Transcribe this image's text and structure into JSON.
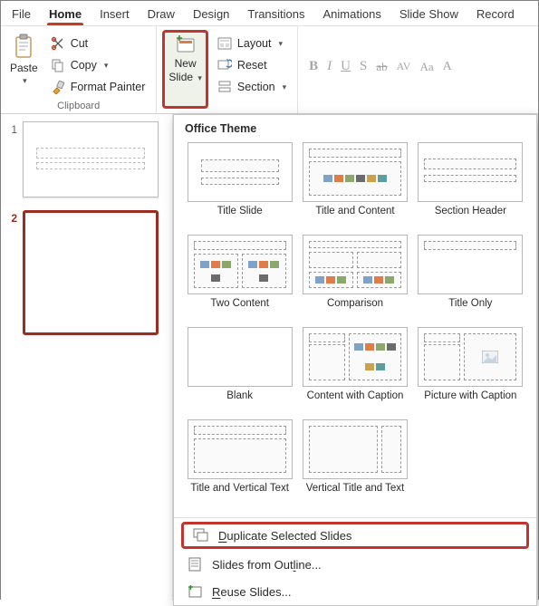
{
  "tabs": [
    "File",
    "Home",
    "Insert",
    "Draw",
    "Design",
    "Transitions",
    "Animations",
    "Slide Show",
    "Record"
  ],
  "active_tab": "Home",
  "clipboard": {
    "group_label": "Clipboard",
    "paste": "Paste",
    "cut": "Cut",
    "copy": "Copy",
    "format_painter": "Format Painter"
  },
  "slides_group": {
    "new_slide_top": "New",
    "new_slide_bottom": "Slide",
    "layout": "Layout",
    "reset": "Reset",
    "section": "Section"
  },
  "font_group": {
    "bold": "B",
    "italic": "I",
    "underline": "U",
    "shadow": "S",
    "strike": "ab",
    "spacing": "AV",
    "case": "Aa",
    "clear": "A"
  },
  "thumbnails": [
    {
      "n": "1",
      "selected": false
    },
    {
      "n": "2",
      "selected": true
    }
  ],
  "gallery": {
    "title": "Office Theme",
    "layouts": [
      "Title Slide",
      "Title and Content",
      "Section Header",
      "Two Content",
      "Comparison",
      "Title Only",
      "Blank",
      "Content with Caption",
      "Picture with Caption",
      "Title and Vertical Text",
      "Vertical Title and Text"
    ],
    "menu": {
      "duplicate": "Duplicate Selected Slides",
      "outline": "Slides from Outline...",
      "reuse": "Reuse Slides..."
    }
  }
}
